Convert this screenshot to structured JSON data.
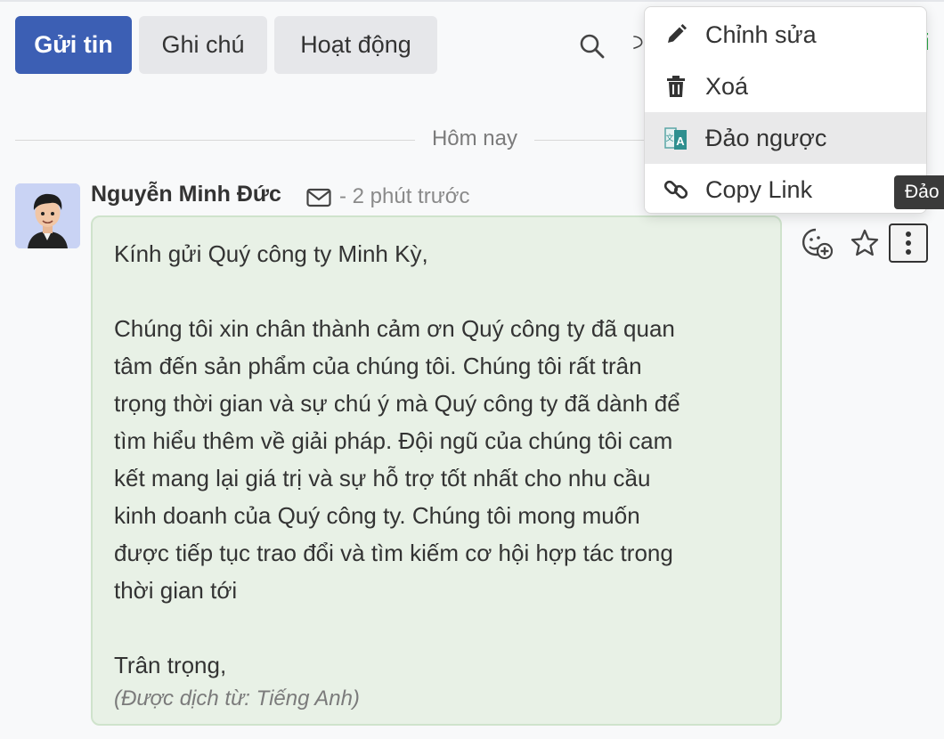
{
  "composer": {
    "send_label": "Gửi tin",
    "note_label": "Ghi chú",
    "activity_label": "Hoạt động",
    "search_icon": "search-icon",
    "peek_text": "i"
  },
  "divider": {
    "label": "Hôm nay"
  },
  "message": {
    "author": "Nguyễn Minh Đức",
    "time": "- 2 phút trước",
    "lines": [
      "Kính gửi Quý công ty Minh Kỳ,",
      "",
      "Chúng tôi xin chân thành cảm ơn Quý công ty đã quan",
      "tâm đến sản phẩm của chúng tôi. Chúng tôi rất trân",
      "trọng thời gian và sự chú ý mà Quý công ty đã dành để",
      "tìm hiểu thêm về giải pháp. Đội ngũ của chúng tôi cam",
      "kết mang lại giá trị và sự hỗ trợ tốt nhất cho nhu cầu",
      "kinh doanh của Quý công ty. Chúng tôi mong muốn",
      "được tiếp tục trao đổi và tìm kiếm cơ hội hợp tác trong",
      "thời gian tới",
      "",
      "Trân trọng,"
    ],
    "translated_note": "(Được dịch từ: Tiếng Anh)",
    "bubble_color": "#e8f1e6"
  },
  "menu": {
    "items": [
      {
        "label": "Chỉnh sửa",
        "icon": "pencil-icon"
      },
      {
        "label": "Xoá",
        "icon": "trash-icon"
      },
      {
        "label": "Đảo ngược",
        "icon": "translate-icon"
      },
      {
        "label": "Copy Link",
        "icon": "link-icon"
      }
    ],
    "hovered_index": 2
  },
  "tooltip": {
    "text": "Đảo"
  },
  "colors": {
    "primary": "#3c5fb4",
    "hover": "#e9e9ea"
  }
}
